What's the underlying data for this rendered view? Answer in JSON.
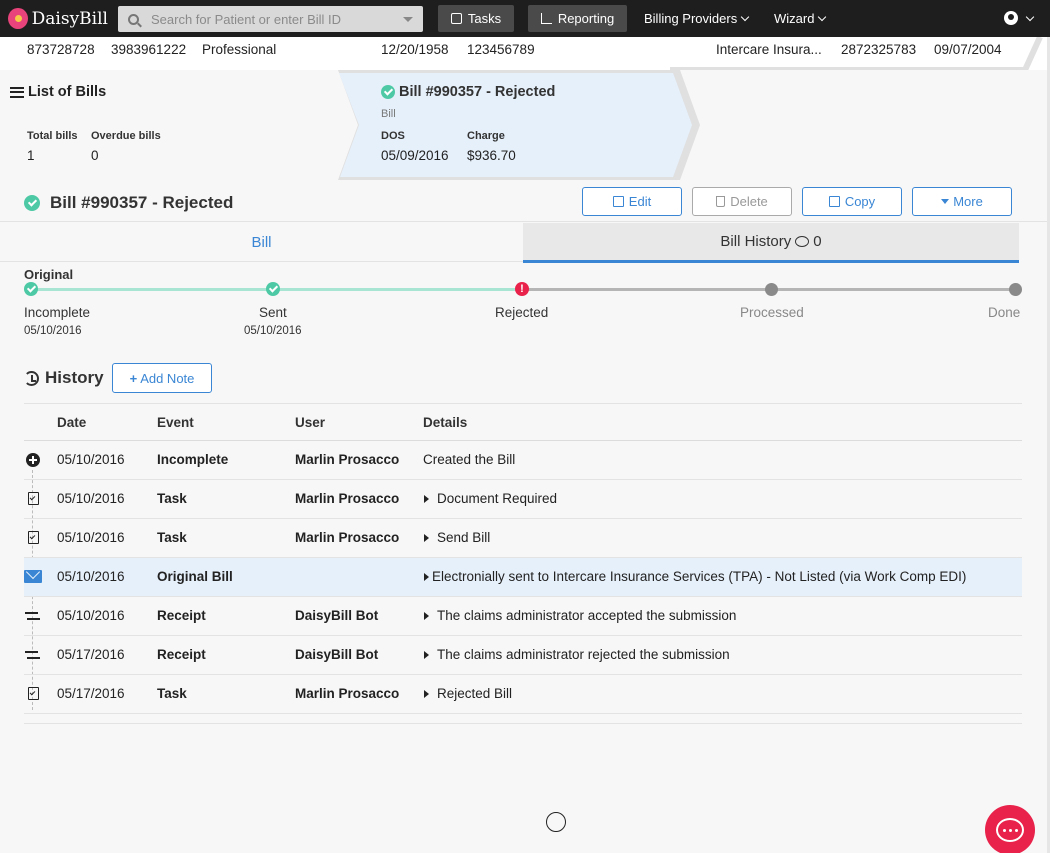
{
  "nav": {
    "brand": "DaisyBill",
    "search_placeholder": "Search for Patient or enter Bill ID",
    "tasks": "Tasks",
    "reporting": "Reporting",
    "billing_providers": "Billing Providers",
    "wizard": "Wizard"
  },
  "strip": {
    "v1": "873728728",
    "v2": "3983961222",
    "v3": "Professional",
    "v4": "12/20/1958",
    "v5": "123456789",
    "v6": "Intercare Insura...",
    "v7": "2872325783",
    "v8": "09/07/2004"
  },
  "list": {
    "title": "List of Bills",
    "total_label": "Total bills",
    "total_value": "1",
    "overdue_label": "Overdue bills",
    "overdue_value": "0"
  },
  "card": {
    "title": "Bill #990357 - Rejected",
    "subtitle": "Bill",
    "dos_label": "DOS",
    "dos_value": "05/09/2016",
    "charge_label": "Charge",
    "charge_value": "$936.70"
  },
  "header": {
    "title": "Bill #990357 - Rejected",
    "edit": "Edit",
    "delete": "Delete",
    "copy": "Copy",
    "more": "More"
  },
  "tabs": {
    "bill": "Bill",
    "history": "Bill History",
    "history_count": "0"
  },
  "progress": {
    "label": "Original",
    "steps": [
      {
        "name": "Incomplete",
        "date": "05/10/2016"
      },
      {
        "name": "Sent",
        "date": "05/10/2016"
      },
      {
        "name": "Rejected",
        "date": ""
      },
      {
        "name": "Processed",
        "date": ""
      },
      {
        "name": "Done",
        "date": ""
      }
    ]
  },
  "history": {
    "title": "History",
    "add_note": "Add Note",
    "columns": [
      "Date",
      "Event",
      "User",
      "Details"
    ],
    "rows": [
      {
        "date": "05/10/2016",
        "event": "Incomplete",
        "user": "Marlin Prosacco",
        "details": "Created the Bill"
      },
      {
        "date": "05/10/2016",
        "event": "Task",
        "user": "Marlin Prosacco",
        "details": "Document Required"
      },
      {
        "date": "05/10/2016",
        "event": "Task",
        "user": "Marlin Prosacco",
        "details": "Send Bill"
      },
      {
        "date": "05/10/2016",
        "event": "Original Bill",
        "user": "",
        "details": "Electronially sent to Intercare Insurance Services (TPA) - Not Listed (via Work Comp EDI)"
      },
      {
        "date": "05/10/2016",
        "event": "Receipt",
        "user": "DaisyBill Bot",
        "details": "The claims administrator accepted the submission"
      },
      {
        "date": "05/17/2016",
        "event": "Receipt",
        "user": "DaisyBill Bot",
        "details": "The claims administrator rejected the submission"
      },
      {
        "date": "05/17/2016",
        "event": "Task",
        "user": "Marlin Prosacco",
        "details": "Rejected Bill"
      }
    ]
  },
  "colors": {
    "accent": "#3a86d4",
    "success": "#4ec9a5",
    "danger": "#e8224a",
    "nav_bg": "#1e1e1e"
  }
}
